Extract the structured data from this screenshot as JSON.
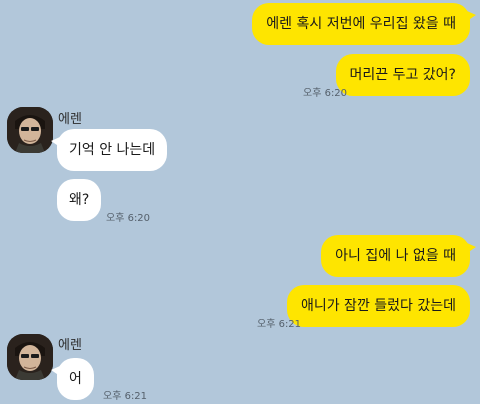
{
  "colors": {
    "background": "#b2c7da",
    "outgoing_bubble": "#fee500",
    "incoming_bubble": "#ffffff",
    "timestamp": "#55606b"
  },
  "messages": {
    "m1": {
      "text": "에렌 혹시 저번에 우리집 왔을 때"
    },
    "m2": {
      "text": "머리끈 두고 갔어?",
      "time": "오후 6:20"
    },
    "g1": {
      "sender": "에렌",
      "avatar_icon": "profile-avatar-icon",
      "m1": "기억 안 나는데",
      "m2": "왜?",
      "time": "오후 6:20"
    },
    "m3": {
      "text": "아니 집에 나 없을 때"
    },
    "m4": {
      "text": "애니가 잠깐 들렀다 갔는데",
      "time": "오후 6:21"
    },
    "g2": {
      "sender": "에렌",
      "avatar_icon": "profile-avatar-icon",
      "m1": "어",
      "time": "오후 6:21"
    }
  }
}
